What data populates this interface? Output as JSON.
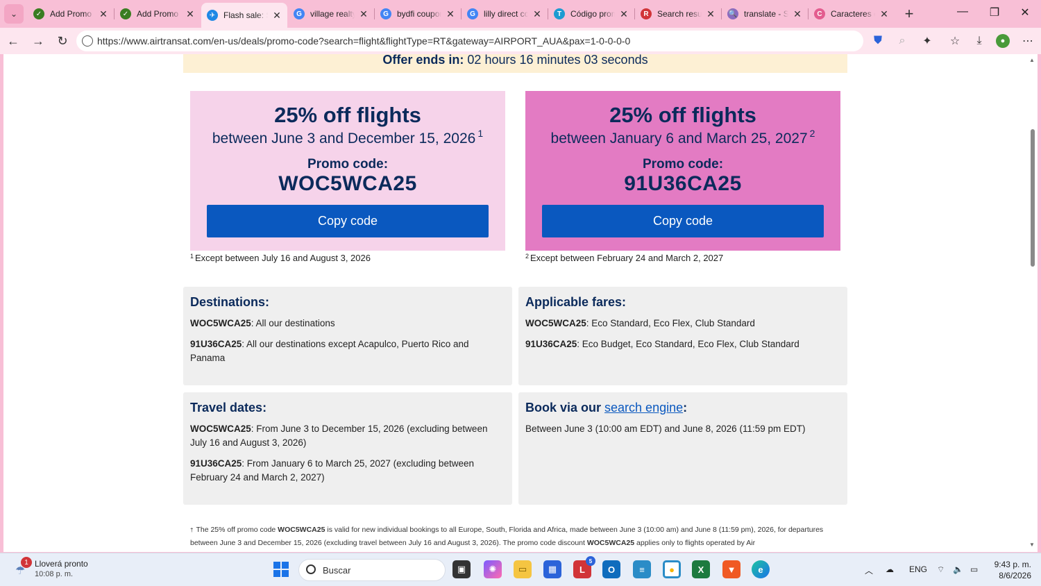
{
  "browser": {
    "tabs": [
      {
        "title": "Add Promo C",
        "fav_color": "#3a7d22",
        "fav_glyph": "✓"
      },
      {
        "title": "Add Promo C",
        "fav_color": "#3a7d22",
        "fav_glyph": "✓"
      },
      {
        "title": "Flash sale: Sa",
        "fav_color": "#1e88e5",
        "fav_glyph": "✈",
        "active": true
      },
      {
        "title": "village realty",
        "fav_color": "#4285f4",
        "fav_glyph": "G"
      },
      {
        "title": "bydfi coupon",
        "fav_color": "#4285f4",
        "fav_glyph": "G"
      },
      {
        "title": "lilly direct co",
        "fav_color": "#4285f4",
        "fav_glyph": "G"
      },
      {
        "title": "Código prom",
        "fav_color": "#1d9bd1",
        "fav_glyph": "T"
      },
      {
        "title": "Search results",
        "fav_color": "#d13438",
        "fav_glyph": "R"
      },
      {
        "title": "translate - Se",
        "fav_color": "#8a6bbf",
        "fav_glyph": "🔍"
      },
      {
        "title": "Caracteres e",
        "fav_color": "#e35d8f",
        "fav_glyph": "C"
      }
    ],
    "url": "https://www.airtransat.com/en-us/deals/promo-code?search=flight&flightType=RT&gateway=AIRPORT_AUA&pax=1-0-0-0-0"
  },
  "offer": {
    "label": "Offer ends in:",
    "countdown": "02 hours 16 minutes 03 seconds"
  },
  "promos": [
    {
      "headline": "25% off flights",
      "period": "between June 3 and December 15, 2026",
      "sup": "1",
      "code_label": "Promo code:",
      "code": "WOC5WCA25",
      "button": "Copy code",
      "footnote_sup": "1",
      "footnote": "Except between July 16 and August 3, 2026"
    },
    {
      "headline": "25% off flights",
      "period": "between January 6 and March 25, 2027",
      "sup": "2",
      "code_label": "Promo code:",
      "code": "91U36CA25",
      "button": "Copy code",
      "footnote_sup": "2",
      "footnote": "Except between February 24 and March 2, 2027"
    }
  ],
  "destinations": {
    "title": "Destinations:",
    "rows": [
      {
        "code": "WOC5WCA25",
        "text": ": All our destinations"
      },
      {
        "code": "91U36CA25",
        "text": ": All our destinations except Acapulco, Puerto Rico and Panama"
      }
    ]
  },
  "fares": {
    "title": "Applicable fares:",
    "rows": [
      {
        "code": "WOC5WCA25",
        "text": ": Eco Standard, Eco Flex, Club Standard"
      },
      {
        "code": "91U36CA25",
        "text": ": Eco Budget, Eco Standard, Eco Flex, Club Standard"
      }
    ]
  },
  "travel": {
    "title": "Travel dates:",
    "rows": [
      {
        "code": "WOC5WCA25",
        "text": ": From June 3 to December 15, 2026 (excluding between July 16 and August 3, 2026)"
      },
      {
        "code": "91U36CA25",
        "text": ": From January 6 to March 25, 2027 (excluding between February 24 and March 2, 2027)"
      }
    ]
  },
  "book": {
    "title_prefix": "Book via our ",
    "title_link": "search engine",
    "title_suffix": ":",
    "text": "Between June 3 (10:00 am EDT) and June 8, 2026 (11:59 pm EDT)"
  },
  "legal": {
    "sup": "†",
    "part1": "The 25% off promo code ",
    "code1": "WOC5WCA25",
    "part2": " is valid for new individual bookings to all Europe, South, Florida and Africa, made between June 3 (10:00 am) and June 8 (11:59 pm), 2026, for departures between June 3 and December 15, 2026 (excluding travel between July 16 and August 3, 2026). The promo code discount ",
    "code2": "WOC5WCA25",
    "part3": " applies only to flights operated by Air"
  },
  "taskbar": {
    "weather_title": "Lloverá pronto",
    "weather_sub": "10:08 p. m.",
    "weather_badge": "1",
    "search_placeholder": "Buscar",
    "lang": "ENG",
    "time": "9:43 p. m.",
    "date": "8/6/2026",
    "mail_count": "5"
  }
}
